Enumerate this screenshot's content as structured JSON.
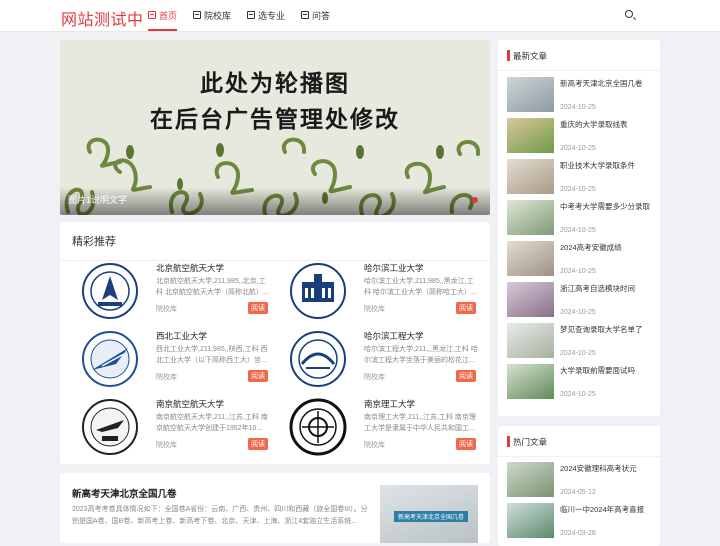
{
  "header": {
    "logo": "网站测试中",
    "nav": [
      {
        "label": "首页",
        "active": true
      },
      {
        "label": "院校库",
        "active": false
      },
      {
        "label": "选专业",
        "active": false
      },
      {
        "label": "问答",
        "active": false
      }
    ],
    "accent_color": "#e4393c"
  },
  "banner": {
    "line1": "此处为轮播图",
    "line2": "在后台广告管理处修改",
    "caption": "图片1说明文字"
  },
  "recommend": {
    "title": "精彩推荐",
    "schools": [
      {
        "name": "北京航空航天大学",
        "desc": "北京航空航天大学,211,985,,北京,工科 北京航空航天大学（简称北航）...",
        "tag": "院校库",
        "button": "阅读"
      },
      {
        "name": "哈尔滨工业大学",
        "desc": "哈尔滨工业大学,211,985,,黑龙江,工科 哈尔滨工业大学（简称哈工大）...",
        "tag": "院校库",
        "button": "阅读"
      },
      {
        "name": "西北工业大学",
        "desc": "西北工业大学,211,985,,陕西,工科 西北工业大学（以下简称西工大）坐...",
        "tag": "院校库",
        "button": "阅读"
      },
      {
        "name": "哈尔滨工程大学",
        "desc": "哈尔滨工程大学,211,,,黑龙江,工科 哈尔滨工程大学坐落于美丽的松花江...",
        "tag": "院校库",
        "button": "阅读"
      },
      {
        "name": "南京航空航天大学",
        "desc": "南京航空航天大学,211,,江苏,工科 南京航空航天大学创建于1952年10...",
        "tag": "院校库",
        "button": "阅读"
      },
      {
        "name": "南京理工大学",
        "desc": "南京理工大学,211,,江苏,工科 南京理工大学是隶属于中华人民共和国工...",
        "tag": "院校库",
        "button": "阅读"
      }
    ]
  },
  "article": {
    "title": "新高考天津北京全国几卷",
    "summary": "2023高考考卷具体情况如下：全国卷A省份：云南、广西、贵州、四川和西藏（旅全国卷III）。分别是国A卷、国B卷、新高考上卷、新高考下卷、北京、天津、上海、浙江4套独立生活系统...",
    "thumb_label": "新高考天津北京全国几卷"
  },
  "latest": {
    "title": "最新文章",
    "items": [
      {
        "title": "新高考天津北京全国几卷",
        "date": "2024-10-25"
      },
      {
        "title": "重庆的大学录取线表",
        "date": "2024-10-25"
      },
      {
        "title": "职业技术大学录取条件",
        "date": "2024-10-25"
      },
      {
        "title": "中考考大学需要多少分录取",
        "date": "2024-10-25"
      },
      {
        "title": "2024高考安徽成绩",
        "date": "2024-10-25"
      },
      {
        "title": "浙江高考自选模块时间",
        "date": "2024-10-25"
      },
      {
        "title": "梦见查询录取大学名单了",
        "date": "2024-10-25"
      },
      {
        "title": "大学录取前需要面试吗",
        "date": "2024-10-25"
      }
    ]
  },
  "hot": {
    "title": "热门文章",
    "items": [
      {
        "title": "2024安徽理科高考状元",
        "date": "2024-05-12"
      },
      {
        "title": "临川一中2024年高考喜报",
        "date": "2024-03-28"
      }
    ]
  }
}
